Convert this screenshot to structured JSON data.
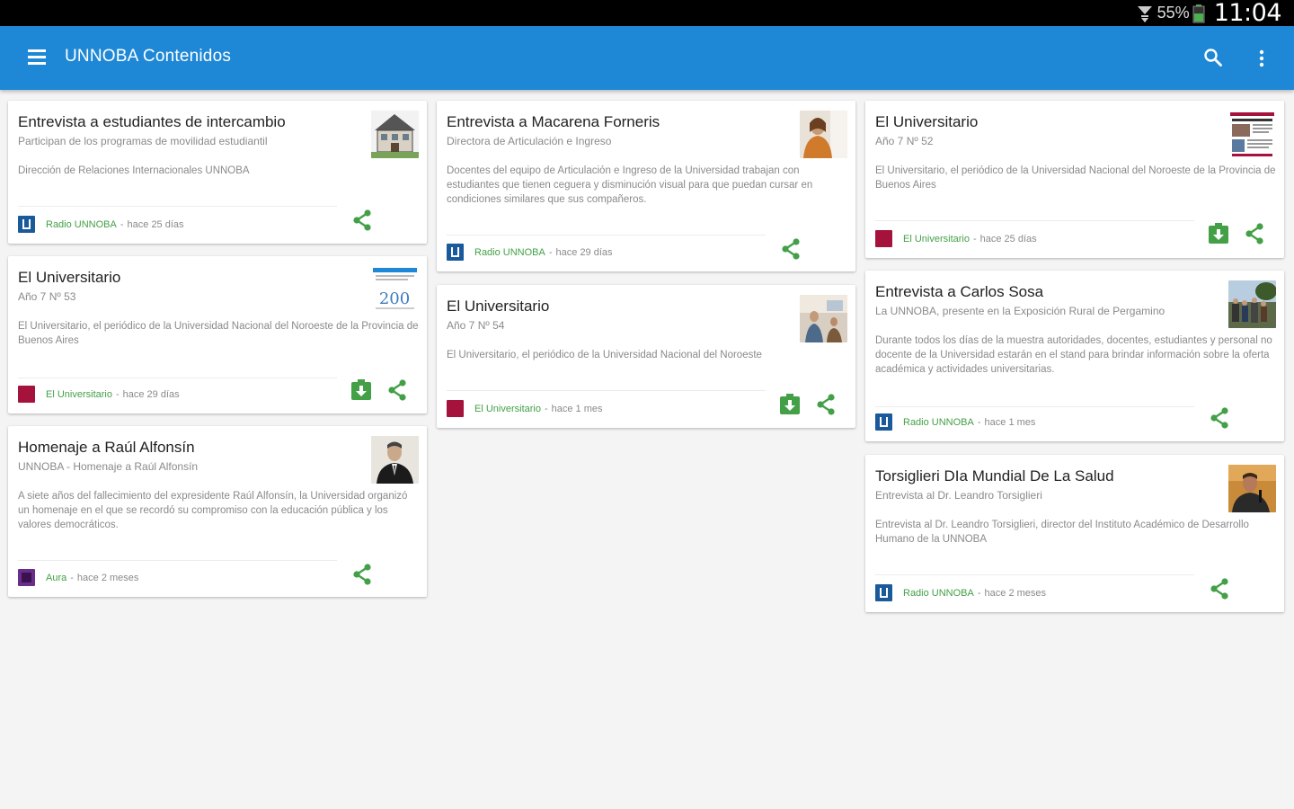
{
  "status_bar": {
    "battery": "55%",
    "time": "11:04"
  },
  "app_bar": {
    "title": "UNNOBA Contenidos"
  },
  "colors": {
    "primary": "#1e88d6",
    "accent_green": "#43a047",
    "radio_source": "#1a5a9a",
    "universitario_source": "#a5123c",
    "aura_source": "#6a2d8a"
  },
  "cards": [
    {
      "title": "Entrevista a estudiantes de intercambio",
      "subtitle": "Participan de los programas de movilidad estudiantil",
      "description": "Dirección de Relaciones Internacionales UNNOBA",
      "source": "Radio UNNOBA",
      "time": "hace 25 días",
      "thumb": "house-image",
      "actions": [
        "share-icon"
      ]
    },
    {
      "title": "El Universitario",
      "subtitle": "Año 7 Nº 53",
      "description": "El Universitario, el periódico de la Universidad Nacional del Noroeste de la Provincia de Buenos Aires",
      "source": "El Universitario",
      "time": "hace 29 días",
      "thumb": "newspaper-200-image",
      "actions": [
        "download-icon",
        "share-icon"
      ]
    },
    {
      "title": "Homenaje a Raúl Alfonsín",
      "subtitle": "UNNOBA - Homenaje a Raúl Alfonsín",
      "description": "A siete años del fallecimiento del expresidente Raúl Alfonsín, la Universidad organizó un homenaje en el que se recordó su compromiso con la educación pública y los valores democráticos.",
      "source": "Aura",
      "time": "hace 2 meses",
      "thumb": "portrait-image",
      "actions": [
        "share-icon"
      ]
    },
    {
      "title": "Entrevista a Macarena Forneris",
      "subtitle": "Directora de Articulación e Ingreso",
      "description": "Docentes del equipo de Articulación e Ingreso de la Universidad trabajan con estudiantes que tienen ceguera y disminución visual para que puedan cursar en condiciones similares que sus compañeros.",
      "source": "Radio UNNOBA",
      "time": "hace 29 días",
      "thumb": "woman-image",
      "actions": [
        "share-icon"
      ]
    },
    {
      "title": "El Universitario",
      "subtitle": "Año 7 Nº 54",
      "description": "El Universitario, el periódico de la Universidad Nacional del Noroeste",
      "source": "El Universitario",
      "time": "hace 1 mes",
      "thumb": "classroom-image",
      "actions": [
        "download-icon",
        "share-icon"
      ]
    },
    {
      "title": "El Universitario",
      "subtitle": "Año 7 Nº 52",
      "description": "El Universitario, el periódico de la Universidad Nacional del Noroeste de la Provincia de Buenos Aires",
      "source": "El Universitario",
      "time": "hace 25 días",
      "thumb": "newspaper-image",
      "actions": [
        "download-icon",
        "share-icon"
      ]
    },
    {
      "title": "Entrevista a Carlos Sosa",
      "subtitle": "La UNNOBA, presente en la Exposición Rural de Pergamino",
      "description": "Durante todos los días de la muestra autoridades, docentes, estudiantes y personal no docente de la Universidad estarán en el stand para brindar información sobre la oferta académica y actividades universitarias.",
      "source": "Radio UNNOBA",
      "time": "hace 1 mes",
      "thumb": "outdoor-image",
      "actions": [
        "share-icon"
      ]
    },
    {
      "title": "Torsiglieri DIa Mundial De La Salud",
      "subtitle": "Entrevista al Dr. Leandro Torsiglieri",
      "description": "Entrevista al Dr. Leandro Torsiglieri, director del Instituto Académico de Desarrollo Humano de la UNNOBA",
      "source": "Radio UNNOBA",
      "time": "hace 2 meses",
      "thumb": "man-speaking-image",
      "actions": [
        "share-icon"
      ]
    }
  ],
  "footer_separator": "-"
}
